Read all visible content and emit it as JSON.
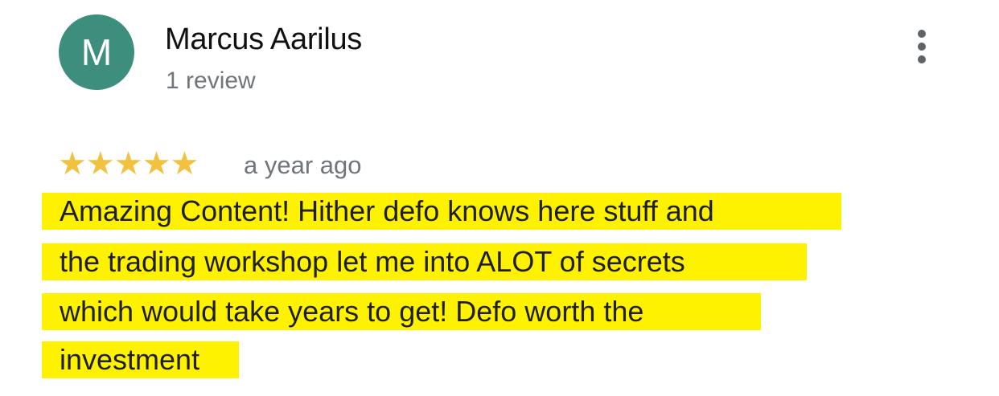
{
  "author": {
    "avatar_letter": "M",
    "avatar_color": "#3e8e7e",
    "name": "Marcus Aarilus",
    "review_count": "1 review"
  },
  "menu": {
    "icon": "more-vert-icon"
  },
  "rating": {
    "stars": 5,
    "stars_glyphs": "★★★★★",
    "star_color": "#f1c240",
    "time_ago": "a year ago"
  },
  "review": {
    "highlight_color": "#fff200",
    "lines": [
      "Amazing Content! Hither defo knows here stuff and",
      "the trading workshop let me into ALOT of secrets",
      "which would take years to get! Defo worth the",
      "investment"
    ]
  }
}
